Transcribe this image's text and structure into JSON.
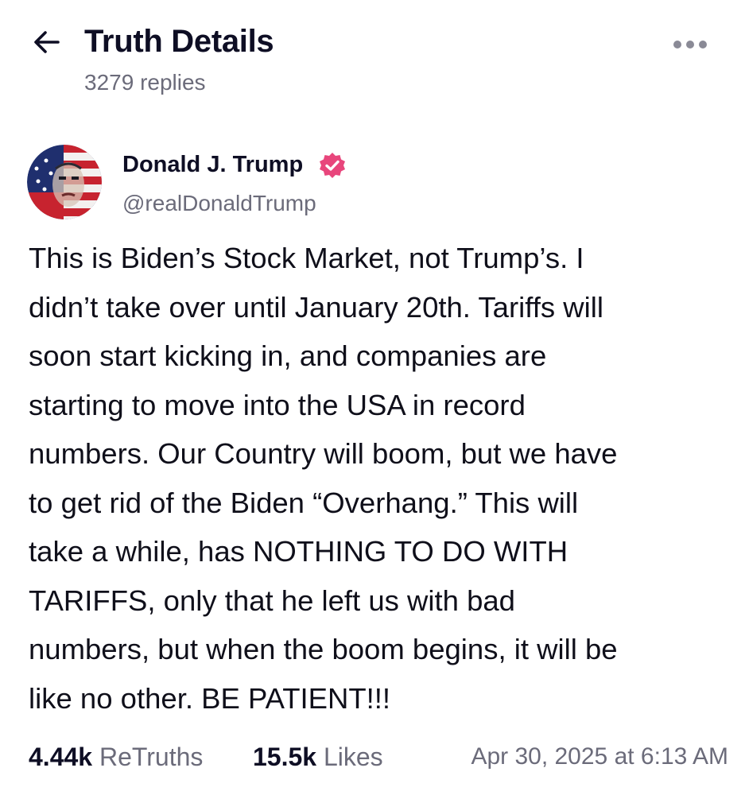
{
  "header": {
    "title": "Truth Details",
    "replies": "3279 replies"
  },
  "author": {
    "name": "Donald J. Trump",
    "handle": "@realDonaldTrump",
    "verified_color": "#e8467c"
  },
  "post": {
    "lines": [
      "This is Biden’s Stock Market, not Trump’s. I",
      "didn’t take over until January 20th. Tariffs will",
      "soon start kicking in, and companies are",
      "starting to move into the USA in record",
      "numbers. Our Country will boom, but we have",
      "to get rid of the Biden “Overhang.” This will",
      "take a while, has NOTHING TO DO WITH",
      "TARIFFS, only that he left us with bad",
      "numbers, but when the boom begins, it will be",
      "like no other. BE PATIENT!!!"
    ]
  },
  "stats": {
    "retruths_count": "4.44k",
    "retruths_label": "ReTruths",
    "likes_count": "15.5k",
    "likes_label": "Likes",
    "timestamp": "Apr 30, 2025 at 6:13 AM"
  }
}
